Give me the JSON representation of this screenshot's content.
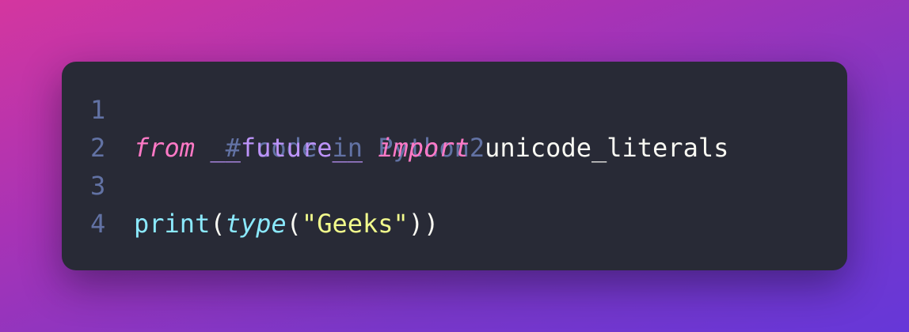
{
  "editor": {
    "lines": [
      {
        "number": "1",
        "tokens": [
          {
            "text": "# code in Python2",
            "type": "comment"
          }
        ]
      },
      {
        "number": "2",
        "tokens": [
          {
            "text": "from",
            "type": "keyword"
          },
          {
            "text": " ",
            "type": "plain"
          },
          {
            "text": "__future__",
            "type": "dunder"
          },
          {
            "text": " ",
            "type": "plain"
          },
          {
            "text": "import",
            "type": "keyword"
          },
          {
            "text": " unicode_literals",
            "type": "plain"
          }
        ]
      },
      {
        "number": "3",
        "tokens": []
      },
      {
        "number": "4",
        "tokens": [
          {
            "text": "print",
            "type": "func"
          },
          {
            "text": "(",
            "type": "plain"
          },
          {
            "text": "type",
            "type": "builtin"
          },
          {
            "text": "(",
            "type": "plain"
          },
          {
            "text": "\"Geeks\"",
            "type": "string"
          },
          {
            "text": "))",
            "type": "plain"
          }
        ]
      }
    ]
  },
  "colors": {
    "background": "#282a36",
    "comment": "#6272a4",
    "keyword": "#ff79c6",
    "dunder": "#bd93f9",
    "plain": "#f8f8f2",
    "function": "#8be9fd",
    "string": "#f1fa8c"
  }
}
